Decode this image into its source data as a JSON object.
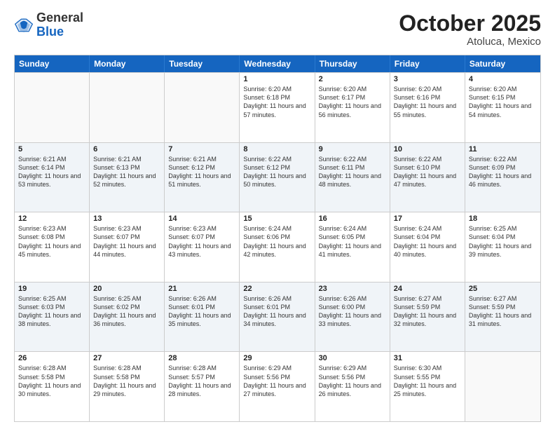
{
  "header": {
    "logo_general": "General",
    "logo_blue": "Blue",
    "month_title": "October 2025",
    "location": "Atoluca, Mexico"
  },
  "weekdays": [
    "Sunday",
    "Monday",
    "Tuesday",
    "Wednesday",
    "Thursday",
    "Friday",
    "Saturday"
  ],
  "rows": [
    [
      {
        "day": "",
        "sunrise": "",
        "sunset": "",
        "daylight": ""
      },
      {
        "day": "",
        "sunrise": "",
        "sunset": "",
        "daylight": ""
      },
      {
        "day": "",
        "sunrise": "",
        "sunset": "",
        "daylight": ""
      },
      {
        "day": "1",
        "sunrise": "Sunrise: 6:20 AM",
        "sunset": "Sunset: 6:18 PM",
        "daylight": "Daylight: 11 hours and 57 minutes."
      },
      {
        "day": "2",
        "sunrise": "Sunrise: 6:20 AM",
        "sunset": "Sunset: 6:17 PM",
        "daylight": "Daylight: 11 hours and 56 minutes."
      },
      {
        "day": "3",
        "sunrise": "Sunrise: 6:20 AM",
        "sunset": "Sunset: 6:16 PM",
        "daylight": "Daylight: 11 hours and 55 minutes."
      },
      {
        "day": "4",
        "sunrise": "Sunrise: 6:20 AM",
        "sunset": "Sunset: 6:15 PM",
        "daylight": "Daylight: 11 hours and 54 minutes."
      }
    ],
    [
      {
        "day": "5",
        "sunrise": "Sunrise: 6:21 AM",
        "sunset": "Sunset: 6:14 PM",
        "daylight": "Daylight: 11 hours and 53 minutes."
      },
      {
        "day": "6",
        "sunrise": "Sunrise: 6:21 AM",
        "sunset": "Sunset: 6:13 PM",
        "daylight": "Daylight: 11 hours and 52 minutes."
      },
      {
        "day": "7",
        "sunrise": "Sunrise: 6:21 AM",
        "sunset": "Sunset: 6:12 PM",
        "daylight": "Daylight: 11 hours and 51 minutes."
      },
      {
        "day": "8",
        "sunrise": "Sunrise: 6:22 AM",
        "sunset": "Sunset: 6:12 PM",
        "daylight": "Daylight: 11 hours and 50 minutes."
      },
      {
        "day": "9",
        "sunrise": "Sunrise: 6:22 AM",
        "sunset": "Sunset: 6:11 PM",
        "daylight": "Daylight: 11 hours and 48 minutes."
      },
      {
        "day": "10",
        "sunrise": "Sunrise: 6:22 AM",
        "sunset": "Sunset: 6:10 PM",
        "daylight": "Daylight: 11 hours and 47 minutes."
      },
      {
        "day": "11",
        "sunrise": "Sunrise: 6:22 AM",
        "sunset": "Sunset: 6:09 PM",
        "daylight": "Daylight: 11 hours and 46 minutes."
      }
    ],
    [
      {
        "day": "12",
        "sunrise": "Sunrise: 6:23 AM",
        "sunset": "Sunset: 6:08 PM",
        "daylight": "Daylight: 11 hours and 45 minutes."
      },
      {
        "day": "13",
        "sunrise": "Sunrise: 6:23 AM",
        "sunset": "Sunset: 6:07 PM",
        "daylight": "Daylight: 11 hours and 44 minutes."
      },
      {
        "day": "14",
        "sunrise": "Sunrise: 6:23 AM",
        "sunset": "Sunset: 6:07 PM",
        "daylight": "Daylight: 11 hours and 43 minutes."
      },
      {
        "day": "15",
        "sunrise": "Sunrise: 6:24 AM",
        "sunset": "Sunset: 6:06 PM",
        "daylight": "Daylight: 11 hours and 42 minutes."
      },
      {
        "day": "16",
        "sunrise": "Sunrise: 6:24 AM",
        "sunset": "Sunset: 6:05 PM",
        "daylight": "Daylight: 11 hours and 41 minutes."
      },
      {
        "day": "17",
        "sunrise": "Sunrise: 6:24 AM",
        "sunset": "Sunset: 6:04 PM",
        "daylight": "Daylight: 11 hours and 40 minutes."
      },
      {
        "day": "18",
        "sunrise": "Sunrise: 6:25 AM",
        "sunset": "Sunset: 6:04 PM",
        "daylight": "Daylight: 11 hours and 39 minutes."
      }
    ],
    [
      {
        "day": "19",
        "sunrise": "Sunrise: 6:25 AM",
        "sunset": "Sunset: 6:03 PM",
        "daylight": "Daylight: 11 hours and 38 minutes."
      },
      {
        "day": "20",
        "sunrise": "Sunrise: 6:25 AM",
        "sunset": "Sunset: 6:02 PM",
        "daylight": "Daylight: 11 hours and 36 minutes."
      },
      {
        "day": "21",
        "sunrise": "Sunrise: 6:26 AM",
        "sunset": "Sunset: 6:01 PM",
        "daylight": "Daylight: 11 hours and 35 minutes."
      },
      {
        "day": "22",
        "sunrise": "Sunrise: 6:26 AM",
        "sunset": "Sunset: 6:01 PM",
        "daylight": "Daylight: 11 hours and 34 minutes."
      },
      {
        "day": "23",
        "sunrise": "Sunrise: 6:26 AM",
        "sunset": "Sunset: 6:00 PM",
        "daylight": "Daylight: 11 hours and 33 minutes."
      },
      {
        "day": "24",
        "sunrise": "Sunrise: 6:27 AM",
        "sunset": "Sunset: 5:59 PM",
        "daylight": "Daylight: 11 hours and 32 minutes."
      },
      {
        "day": "25",
        "sunrise": "Sunrise: 6:27 AM",
        "sunset": "Sunset: 5:59 PM",
        "daylight": "Daylight: 11 hours and 31 minutes."
      }
    ],
    [
      {
        "day": "26",
        "sunrise": "Sunrise: 6:28 AM",
        "sunset": "Sunset: 5:58 PM",
        "daylight": "Daylight: 11 hours and 30 minutes."
      },
      {
        "day": "27",
        "sunrise": "Sunrise: 6:28 AM",
        "sunset": "Sunset: 5:58 PM",
        "daylight": "Daylight: 11 hours and 29 minutes."
      },
      {
        "day": "28",
        "sunrise": "Sunrise: 6:28 AM",
        "sunset": "Sunset: 5:57 PM",
        "daylight": "Daylight: 11 hours and 28 minutes."
      },
      {
        "day": "29",
        "sunrise": "Sunrise: 6:29 AM",
        "sunset": "Sunset: 5:56 PM",
        "daylight": "Daylight: 11 hours and 27 minutes."
      },
      {
        "day": "30",
        "sunrise": "Sunrise: 6:29 AM",
        "sunset": "Sunset: 5:56 PM",
        "daylight": "Daylight: 11 hours and 26 minutes."
      },
      {
        "day": "31",
        "sunrise": "Sunrise: 6:30 AM",
        "sunset": "Sunset: 5:55 PM",
        "daylight": "Daylight: 11 hours and 25 minutes."
      },
      {
        "day": "",
        "sunrise": "",
        "sunset": "",
        "daylight": ""
      }
    ]
  ]
}
